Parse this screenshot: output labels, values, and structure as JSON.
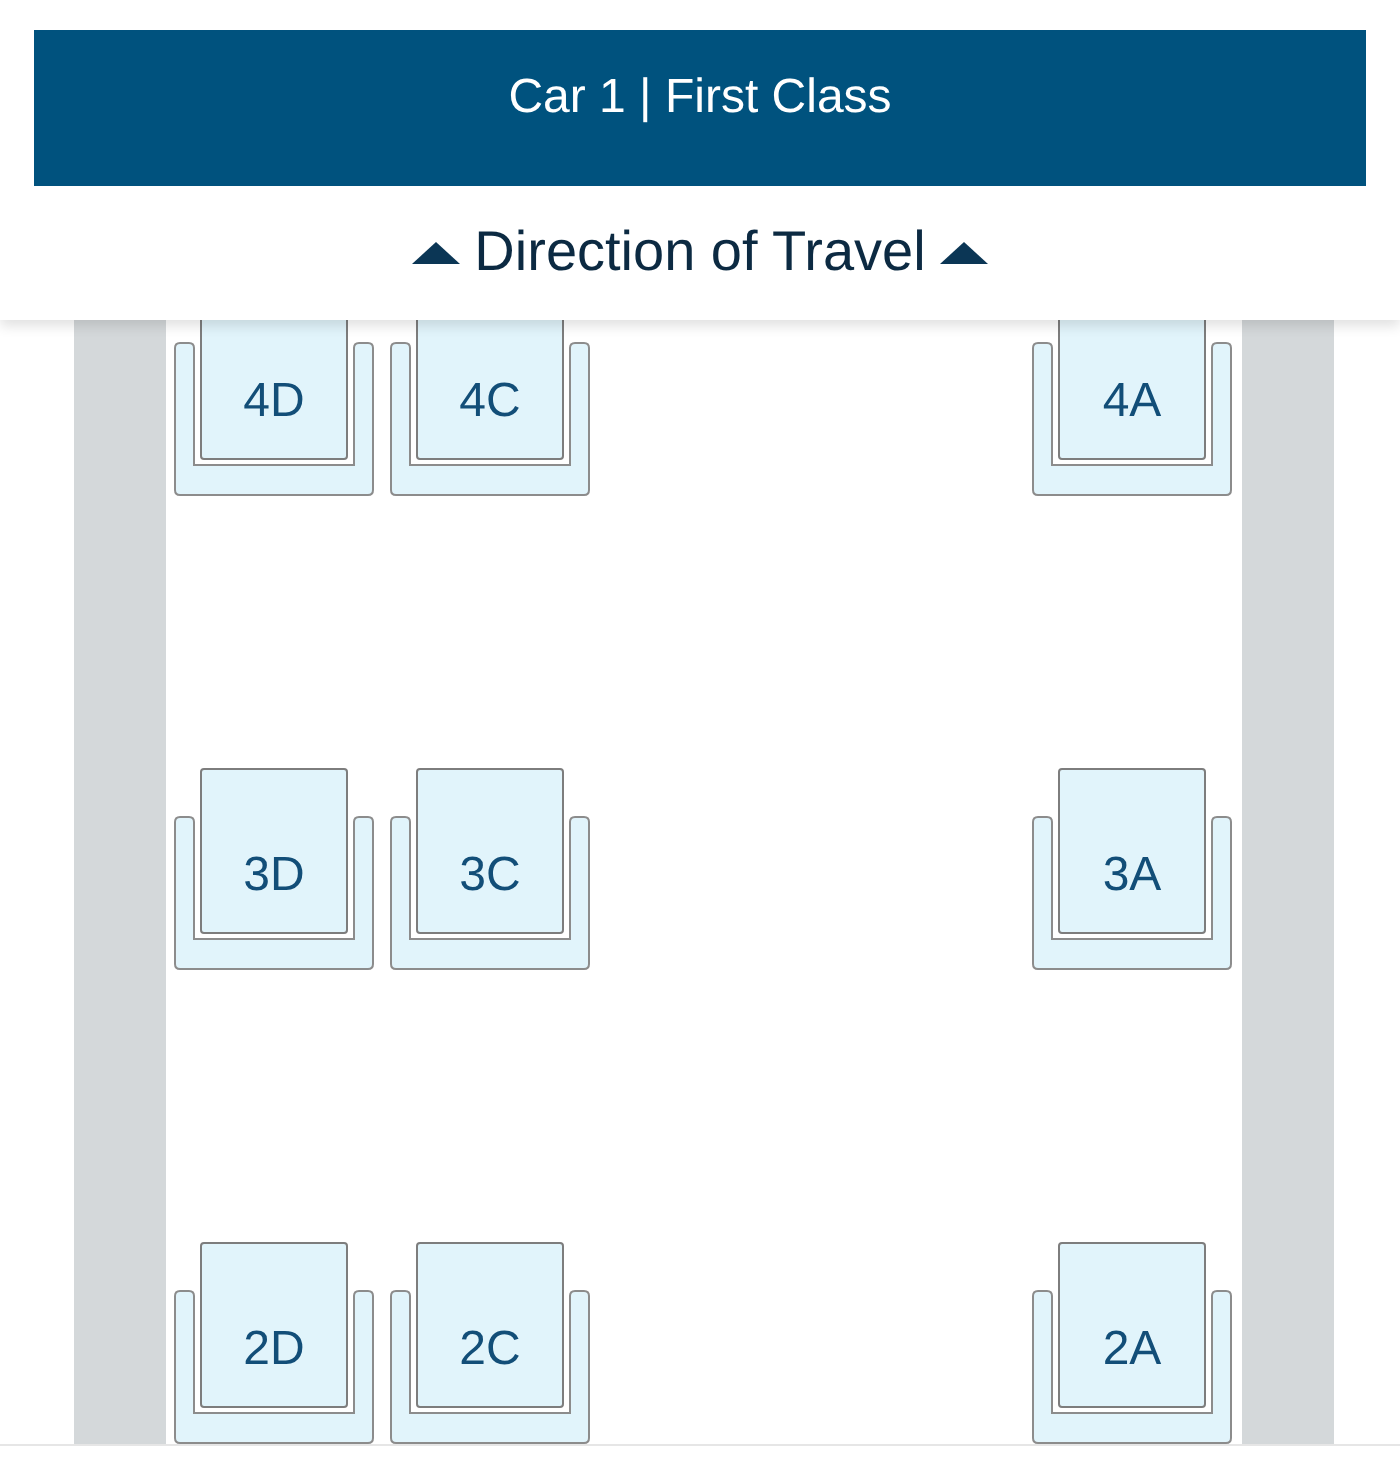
{
  "header": {
    "title": "Car 1 | First Class",
    "direction": "Direction of Travel"
  },
  "rows": [
    {
      "left": [
        "4D",
        "4C"
      ],
      "right": [
        "4A"
      ]
    },
    {
      "left": [
        "3D",
        "3C"
      ],
      "right": [
        "3A"
      ]
    },
    {
      "left": [
        "2D",
        "2C"
      ],
      "right": [
        "2A"
      ]
    }
  ]
}
